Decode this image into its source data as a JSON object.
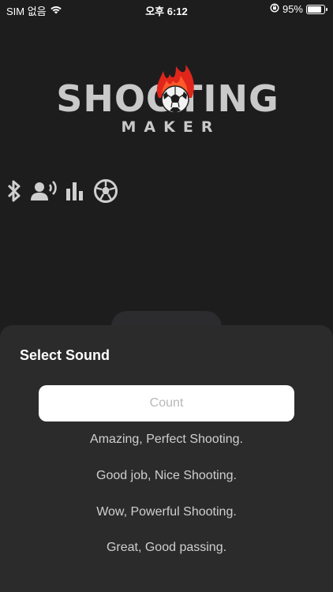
{
  "status_bar": {
    "carrier": "SIM 없음",
    "time": "오후 6:12",
    "battery_percent": "95%",
    "battery_level": 0.95
  },
  "logo": {
    "title": "SHOOTING",
    "subtitle": "MAKER"
  },
  "toolbar_icons": [
    "bluetooth-icon",
    "voice-icon",
    "bar-chart-icon",
    "soccer-ball-icon"
  ],
  "sheet": {
    "title": "Select Sound",
    "options": [
      {
        "label": "Count",
        "selected": true
      },
      {
        "label": "Amazing, Perfect Shooting.",
        "selected": false
      },
      {
        "label": "Good job, Nice Shooting.",
        "selected": false
      },
      {
        "label": "Wow, Powerful Shooting.",
        "selected": false
      },
      {
        "label": "Great, Good passing.",
        "selected": false
      }
    ]
  },
  "colors": {
    "background": "#1e1d1e",
    "sheet": "#2b2b2b",
    "logo_gray": "#c9c9c9",
    "flame_red": "#e0261b"
  }
}
